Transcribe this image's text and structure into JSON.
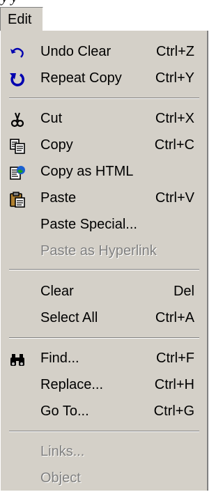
{
  "caption_text": "y                        y",
  "menubar": {
    "label": "Edit"
  },
  "menu": {
    "items": [
      {
        "label": "Undo Clear",
        "shortcut": "Ctrl+Z",
        "icon": "undo-icon"
      },
      {
        "label": "Repeat Copy",
        "shortcut": "Ctrl+Y",
        "icon": "repeat-icon"
      },
      {
        "label": "Cut",
        "shortcut": "Ctrl+X",
        "icon": "scissors-icon"
      },
      {
        "label": "Copy",
        "shortcut": "Ctrl+C",
        "icon": "copy-icon"
      },
      {
        "label": "Copy as HTML",
        "shortcut": "",
        "icon": "copy-as-html-icon"
      },
      {
        "label": "Paste",
        "shortcut": "Ctrl+V",
        "icon": "clipboard-icon"
      },
      {
        "label": "Paste Special...",
        "shortcut": ""
      },
      {
        "label": "Paste as Hyperlink",
        "shortcut": "",
        "disabled": true
      },
      {
        "label": "Clear",
        "shortcut": "Del"
      },
      {
        "label": "Select All",
        "shortcut": "Ctrl+A"
      },
      {
        "label": "Find...",
        "shortcut": "Ctrl+F",
        "icon": "binoculars-icon"
      },
      {
        "label": "Replace...",
        "shortcut": "Ctrl+H"
      },
      {
        "label": "Go To...",
        "shortcut": "Ctrl+G"
      },
      {
        "label": "Links...",
        "shortcut": "",
        "disabled": true
      },
      {
        "label": "Object",
        "shortcut": "",
        "disabled": true
      }
    ]
  },
  "colors": {
    "menu_bg": "#d4d0c8",
    "disabled_text": "#808080",
    "highlight": "#ffffff",
    "shadow": "#808080"
  }
}
